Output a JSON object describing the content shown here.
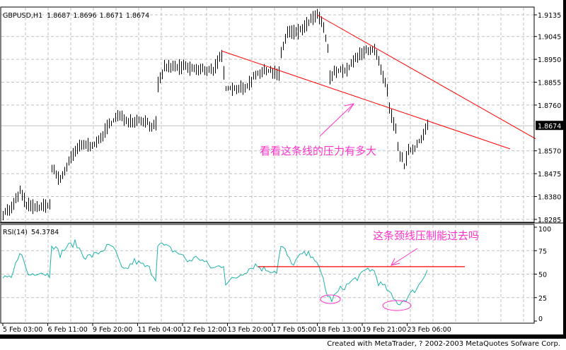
{
  "header": {
    "symbol": "GBPUSD,H1",
    "open": "1.8687",
    "high": "1.8696",
    "low": "1.8671",
    "close": "1.8674"
  },
  "rsi_header": {
    "label": "RSI(14)",
    "value": "54.3784"
  },
  "footer": {
    "credit": "Created with MetaTrader, ? 2002-2003 MetaQuotes Sofware Corp."
  },
  "annotations": {
    "price_note": "看看这条线的压力有多大",
    "rsi_note": "这条颈线压制能过去吗"
  },
  "colors": {
    "bars": "#000000",
    "rsi": "#20b2aa",
    "trendline": "#ff0000",
    "annotation": "#ff33cc",
    "grid": "#c0c0c0"
  },
  "chart_data": [
    {
      "type": "bar",
      "title": "GBPUSD,H1",
      "ylim": [
        1.8265,
        1.917
      ],
      "y_ticks": [
        "1.9135",
        "1.9045",
        "1.8950",
        "1.8855",
        "1.8760",
        "1.8570",
        "1.8475",
        "1.8380",
        "1.8285"
      ],
      "current_price": "1.8674",
      "x_ticks": [
        "5 Feb 03:00",
        "6 Feb 11:00",
        "9 Feb 20:00",
        "11 Feb 04:00",
        "12 Feb 12:00",
        "13 Feb 20:00",
        "17 Feb 05:00",
        "18 Feb 13:00",
        "19 Feb 21:00",
        "23 Feb 06:00"
      ],
      "bar_count": 201,
      "close_path": [
        [
          0,
          1.8312
        ],
        [
          4,
          1.8332
        ],
        [
          8,
          1.84
        ],
        [
          11,
          1.8347
        ],
        [
          16,
          1.8332
        ],
        [
          22,
          1.8347
        ],
        [
          23,
          1.8493
        ],
        [
          27,
          1.8449
        ],
        [
          31,
          1.8523
        ],
        [
          35,
          1.8581
        ],
        [
          39,
          1.8596
        ],
        [
          44,
          1.8596
        ],
        [
          49,
          1.8669
        ],
        [
          54,
          1.8713
        ],
        [
          59,
          1.8698
        ],
        [
          66,
          1.8698
        ],
        [
          71,
          1.8669
        ],
        [
          72,
          1.8684
        ],
        [
          73,
          1.8845
        ],
        [
          76,
          1.8918
        ],
        [
          79,
          1.8918
        ],
        [
          86,
          1.8918
        ],
        [
          92,
          1.8904
        ],
        [
          99,
          1.8909
        ],
        [
          103,
          1.8962
        ],
        [
          105,
          1.883
        ],
        [
          109,
          1.883
        ],
        [
          114,
          1.883
        ],
        [
          119,
          1.8889
        ],
        [
          126,
          1.8904
        ],
        [
          130,
          1.8889
        ],
        [
          131,
          1.8977
        ],
        [
          134,
          1.9065
        ],
        [
          139,
          1.9065
        ],
        [
          143,
          1.9094
        ],
        [
          148,
          1.9138
        ],
        [
          151,
          1.9079
        ],
        [
          153,
          1.8991
        ],
        [
          154,
          1.8874
        ],
        [
          157,
          1.8904
        ],
        [
          162,
          1.8904
        ],
        [
          167,
          1.8962
        ],
        [
          172,
          1.8991
        ],
        [
          175,
          1.8991
        ],
        [
          177,
          1.8933
        ],
        [
          181,
          1.8816
        ],
        [
          182,
          1.8743
        ],
        [
          185,
          1.8654
        ],
        [
          186,
          1.8581
        ],
        [
          189,
          1.8508
        ],
        [
          191,
          1.8567
        ],
        [
          194,
          1.8581
        ],
        [
          197,
          1.8625
        ],
        [
          200,
          1.8674
        ]
      ],
      "trendlines": [
        {
          "from": [
            103,
            1.8985
          ],
          "to": [
            239,
            1.8578
          ]
        },
        {
          "from": [
            148,
            1.9135
          ],
          "to": [
            251,
            1.862
          ]
        }
      ]
    },
    {
      "type": "line",
      "title": "RSI(14)",
      "ylim": [
        0,
        100
      ],
      "y_ticks": [
        "100",
        "75",
        "50",
        "25",
        "0"
      ],
      "series": [
        {
          "name": "RSI(14)",
          "path": [
            [
              0,
              45
            ],
            [
              4,
              45
            ],
            [
              6,
              60
            ],
            [
              8,
              75
            ],
            [
              11,
              56
            ],
            [
              12,
              49
            ],
            [
              17,
              53
            ],
            [
              22,
              49
            ],
            [
              23,
              83
            ],
            [
              27,
              71
            ],
            [
              30,
              79
            ],
            [
              34,
              83
            ],
            [
              39,
              68
            ],
            [
              44,
              71
            ],
            [
              49,
              79
            ],
            [
              52,
              79
            ],
            [
              56,
              56
            ],
            [
              57,
              53
            ],
            [
              62,
              64
            ],
            [
              69,
              56
            ],
            [
              72,
              45
            ],
            [
              73,
              83
            ],
            [
              77,
              79
            ],
            [
              84,
              71
            ],
            [
              87,
              64
            ],
            [
              92,
              68
            ],
            [
              99,
              56
            ],
            [
              104,
              60
            ],
            [
              105,
              41
            ],
            [
              109,
              45
            ],
            [
              114,
              53
            ],
            [
              119,
              60
            ],
            [
              122,
              56
            ],
            [
              129,
              53
            ],
            [
              131,
              79
            ],
            [
              133,
              75
            ],
            [
              136,
              60
            ],
            [
              141,
              71
            ],
            [
              146,
              71
            ],
            [
              148,
              60
            ],
            [
              151,
              45
            ],
            [
              153,
              26
            ],
            [
              155,
              23
            ],
            [
              159,
              34
            ],
            [
              162,
              38
            ],
            [
              166,
              45
            ],
            [
              169,
              49
            ],
            [
              172,
              56
            ],
            [
              175,
              53
            ],
            [
              177,
              41
            ],
            [
              181,
              34
            ],
            [
              184,
              23
            ],
            [
              187,
              19
            ],
            [
              191,
              26
            ],
            [
              196,
              38
            ],
            [
              200,
              54.38
            ]
          ]
        }
      ],
      "level_line": 58
    }
  ]
}
